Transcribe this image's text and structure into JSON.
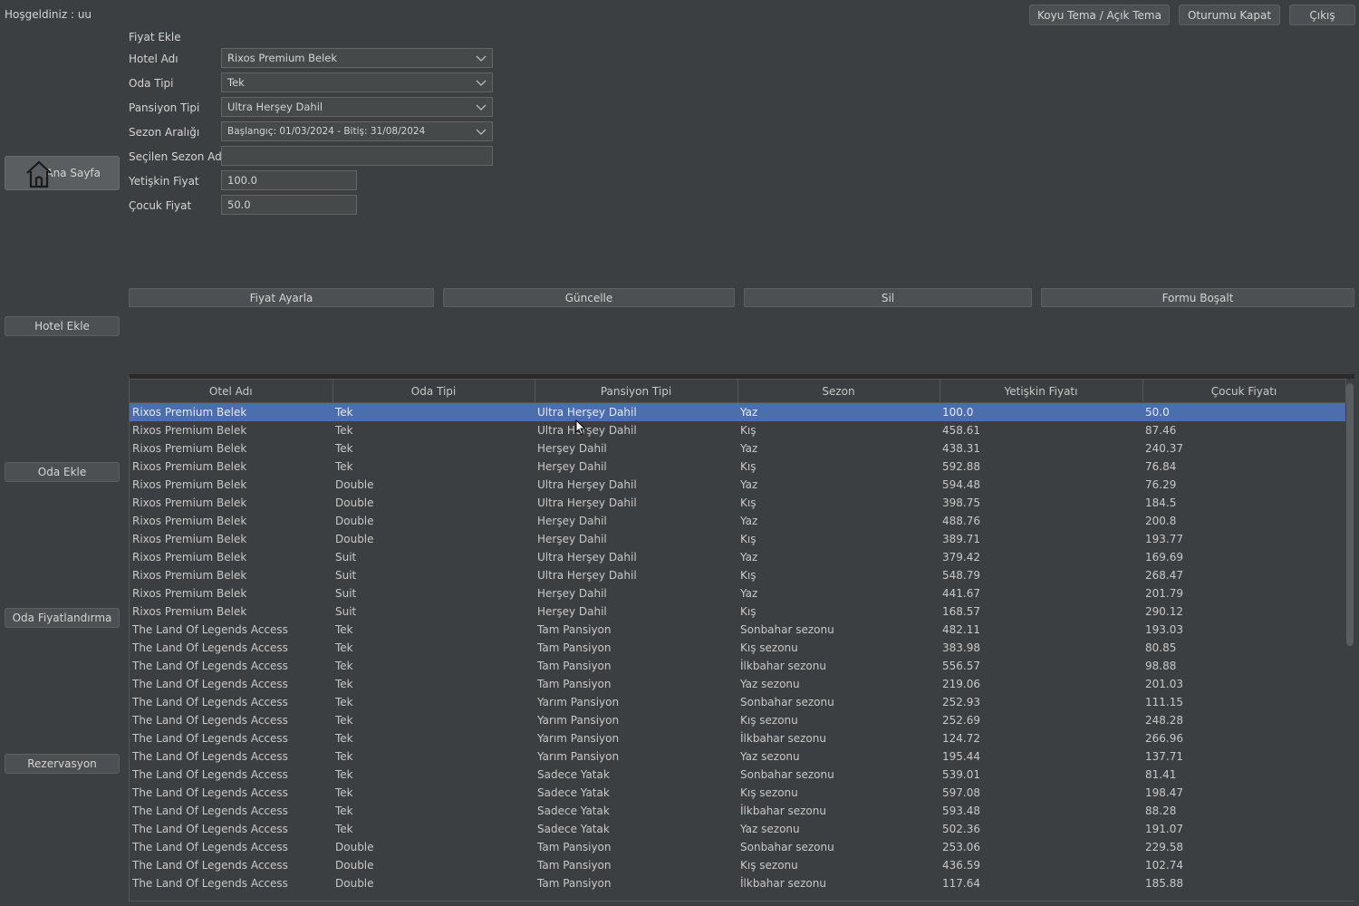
{
  "header": {
    "welcome": "Hoşgeldiniz : uu",
    "theme_button": "Koyu Tema / Açık Tema",
    "logout_button": "Oturumu Kapat",
    "exit_button": "Çıkış"
  },
  "sidebar": {
    "home": "Ana Sayfa",
    "hotel_add": "Hotel Ekle",
    "room_add": "Oda Ekle",
    "room_pricing": "Oda Fiyatlandırma",
    "reservation": "Rezervasyon"
  },
  "form": {
    "title": "Fiyat Ekle",
    "hotel_label": "Hotel Adı",
    "hotel_value": "Rixos Premium Belek",
    "room_label": "Oda Tipi",
    "room_value": "Tek",
    "board_label": "Pansiyon Tipi",
    "board_value": "Ultra Herşey Dahil",
    "season_label": "Sezon Aralığı",
    "season_value": "Başlangıç: 01/03/2024 - Bitiş: 31/08/2024",
    "season_name_label": "Seçilen Sezon Adı",
    "season_name_value": "",
    "adult_label": "Yetişkin Fiyat",
    "adult_value": "100.0",
    "child_label": "Çocuk Fiyat",
    "child_value": "50.0"
  },
  "actions": {
    "set_price": "Fiyat Ayarla",
    "update": "Güncelle",
    "delete": "Sil",
    "clear": "Formu Boşalt"
  },
  "table": {
    "columns": [
      "Otel Adı",
      "Oda Tipi",
      "Pansiyon Tipi",
      "Sezon",
      "Yetişkin Fiyatı",
      "Çocuk Fiyatı"
    ],
    "selected_row": 0,
    "rows": [
      [
        "Rixos Premium Belek",
        "Tek",
        "Ultra Herşey Dahil",
        "Yaz",
        "100.0",
        "50.0"
      ],
      [
        "Rixos Premium Belek",
        "Tek",
        "Ultra Herşey Dahil",
        "Kış",
        "458.61",
        "87.46"
      ],
      [
        "Rixos Premium Belek",
        "Tek",
        "Herşey Dahil",
        "Yaz",
        "438.31",
        "240.37"
      ],
      [
        "Rixos Premium Belek",
        "Tek",
        "Herşey Dahil",
        "Kış",
        "592.88",
        "76.84"
      ],
      [
        "Rixos Premium Belek",
        "Double",
        "Ultra Herşey Dahil",
        "Yaz",
        "594.48",
        "76.29"
      ],
      [
        "Rixos Premium Belek",
        "Double",
        "Ultra Herşey Dahil",
        "Kış",
        "398.75",
        "184.5"
      ],
      [
        "Rixos Premium Belek",
        "Double",
        "Herşey Dahil",
        "Yaz",
        "488.76",
        "200.8"
      ],
      [
        "Rixos Premium Belek",
        "Double",
        "Herşey Dahil",
        "Kış",
        "389.71",
        "193.77"
      ],
      [
        "Rixos Premium Belek",
        "Suit",
        "Ultra Herşey Dahil",
        "Yaz",
        "379.42",
        "169.69"
      ],
      [
        "Rixos Premium Belek",
        "Suit",
        "Ultra Herşey Dahil",
        "Kış",
        "548.79",
        "268.47"
      ],
      [
        "Rixos Premium Belek",
        "Suit",
        "Herşey Dahil",
        "Yaz",
        "441.67",
        "201.79"
      ],
      [
        "Rixos Premium Belek",
        "Suit",
        "Herşey Dahil",
        "Kış",
        "168.57",
        "290.12"
      ],
      [
        "The Land Of Legends Access",
        "Tek",
        "Tam Pansiyon",
        "Sonbahar sezonu",
        "482.11",
        "193.03"
      ],
      [
        "The Land Of Legends Access",
        "Tek",
        "Tam Pansiyon",
        "Kış sezonu",
        "383.98",
        "80.85"
      ],
      [
        "The Land Of Legends Access",
        "Tek",
        "Tam Pansiyon",
        "İlkbahar sezonu",
        "556.57",
        "98.88"
      ],
      [
        "The Land Of Legends Access",
        "Tek",
        "Tam Pansiyon",
        "Yaz sezonu",
        "219.06",
        "201.03"
      ],
      [
        "The Land Of Legends Access",
        "Tek",
        "Yarım Pansiyon",
        "Sonbahar sezonu",
        "252.93",
        "111.15"
      ],
      [
        "The Land Of Legends Access",
        "Tek",
        "Yarım Pansiyon",
        "Kış sezonu",
        "252.69",
        "248.28"
      ],
      [
        "The Land Of Legends Access",
        "Tek",
        "Yarım Pansiyon",
        "İlkbahar sezonu",
        "124.72",
        "266.96"
      ],
      [
        "The Land Of Legends Access",
        "Tek",
        "Yarım Pansiyon",
        "Yaz sezonu",
        "195.44",
        "137.71"
      ],
      [
        "The Land Of Legends Access",
        "Tek",
        "Sadece Yatak",
        "Sonbahar sezonu",
        "539.01",
        "81.41"
      ],
      [
        "The Land Of Legends Access",
        "Tek",
        "Sadece Yatak",
        "Kış sezonu",
        "597.08",
        "198.47"
      ],
      [
        "The Land Of Legends Access",
        "Tek",
        "Sadece Yatak",
        "İlkbahar sezonu",
        "593.48",
        "88.28"
      ],
      [
        "The Land Of Legends Access",
        "Tek",
        "Sadece Yatak",
        "Yaz sezonu",
        "502.36",
        "191.07"
      ],
      [
        "The Land Of Legends Access",
        "Double",
        "Tam Pansiyon",
        "Sonbahar sezonu",
        "253.06",
        "229.58"
      ],
      [
        "The Land Of Legends Access",
        "Double",
        "Tam Pansiyon",
        "Kış sezonu",
        "436.59",
        "102.74"
      ],
      [
        "The Land Of Legends Access",
        "Double",
        "Tam Pansiyon",
        "İlkbahar sezonu",
        "117.64",
        "185.88"
      ]
    ]
  }
}
